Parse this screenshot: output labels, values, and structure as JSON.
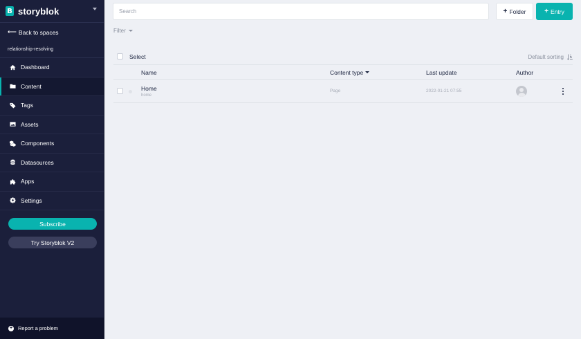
{
  "app": {
    "brand": "storyblok",
    "logo_letter": "B"
  },
  "sidebar": {
    "back_label": "Back to spaces",
    "space_name": "relationship-resolving",
    "items": [
      {
        "label": "Dashboard",
        "icon": "home-icon"
      },
      {
        "label": "Content",
        "icon": "folder-icon",
        "active": true
      },
      {
        "label": "Tags",
        "icon": "tags-icon"
      },
      {
        "label": "Assets",
        "icon": "image-icon"
      },
      {
        "label": "Components",
        "icon": "cubes-icon"
      },
      {
        "label": "Datasources",
        "icon": "database-icon"
      },
      {
        "label": "Apps",
        "icon": "puzzle-icon"
      },
      {
        "label": "Settings",
        "icon": "gear-icon"
      }
    ],
    "subscribe_label": "Subscribe",
    "try_v2_label": "Try Storyblok V2",
    "report_label": "Report a problem"
  },
  "toolbar": {
    "search_placeholder": "Search",
    "folder_label": "Folder",
    "entry_label": "Entry"
  },
  "content": {
    "filter_label": "Filter",
    "select_label": "Select",
    "sorting_label": "Default sorting",
    "columns": {
      "name": "Name",
      "content_type": "Content type",
      "last_update": "Last update",
      "author": "Author"
    },
    "rows": [
      {
        "name": "Home",
        "slug": "home",
        "content_type": "Page",
        "last_update": "2022-01-21 07:55"
      }
    ]
  },
  "colors": {
    "accent": "#09b3af",
    "sidebar_bg": "#1b1f3b",
    "main_bg": "#eef0f5"
  }
}
